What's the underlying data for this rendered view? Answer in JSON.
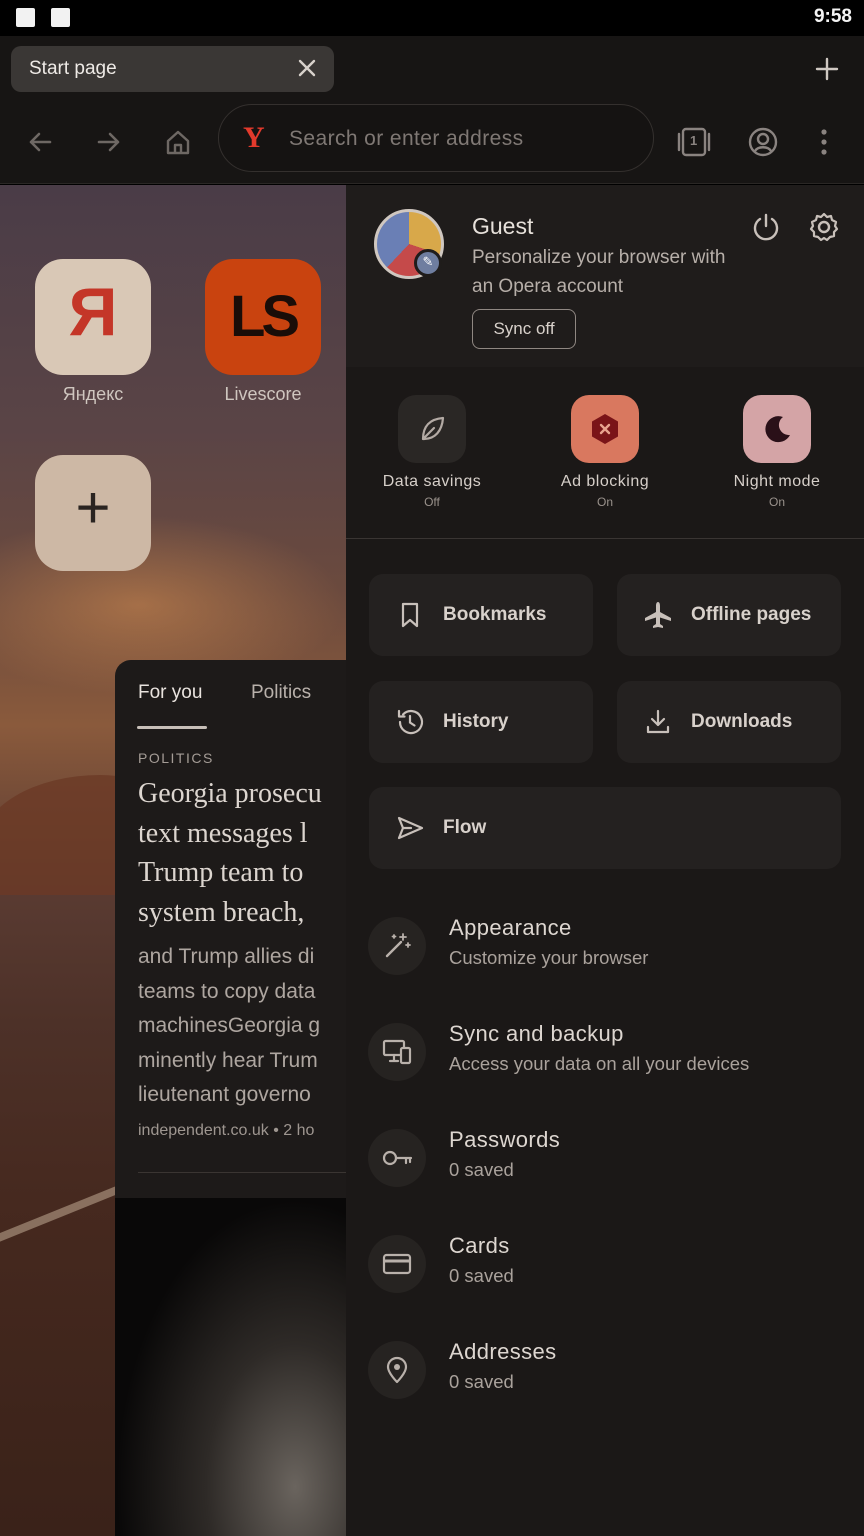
{
  "status_bar": {
    "time": "9:58"
  },
  "tab": {
    "title": "Start page"
  },
  "toolbar": {
    "search_placeholder": "Search or enter address",
    "search_engine_logo": "Y",
    "tab_count": "1"
  },
  "speed_dial": [
    {
      "label": "Яндекс",
      "glyph": "Я"
    },
    {
      "label": "Livescore",
      "glyph": "LS"
    },
    {
      "label": "",
      "glyph": "+"
    }
  ],
  "news": {
    "tabs": [
      "For you",
      "Politics"
    ],
    "category": "POLITICS",
    "headline": "Georgia prosecu\ntext messages l\nTrump team to \nsystem breach,",
    "body": "and Trump allies di\nteams to copy data\nmachinesGeorgia g\nminently hear Trum\nlieutenant governo",
    "source": "independent.co.uk • 2 ho"
  },
  "menu": {
    "profile": {
      "name": "Guest",
      "description": "Personalize your browser with an Opera account",
      "sync_label": "Sync off"
    },
    "toggles": [
      {
        "label": "Data savings",
        "state": "Off",
        "icon": "leaf-icon"
      },
      {
        "label": "Ad blocking",
        "state": "On",
        "icon": "ad-block-icon"
      },
      {
        "label": "Night mode",
        "state": "On",
        "icon": "moon-icon"
      }
    ],
    "grid": [
      {
        "label": "Bookmarks",
        "icon": "bookmark-icon"
      },
      {
        "label": "Offline pages",
        "icon": "airplane-icon"
      },
      {
        "label": "History",
        "icon": "history-icon"
      },
      {
        "label": "Downloads",
        "icon": "download-icon"
      },
      {
        "label": "Flow",
        "icon": "send-icon"
      }
    ],
    "list": [
      {
        "title": "Appearance",
        "subtitle": "Customize your browser",
        "icon": "magic-wand-icon"
      },
      {
        "title": "Sync and backup",
        "subtitle": "Access your data on all your devices",
        "icon": "devices-icon"
      },
      {
        "title": "Passwords",
        "subtitle": "0 saved",
        "icon": "key-icon"
      },
      {
        "title": "Cards",
        "subtitle": "0 saved",
        "icon": "card-icon"
      },
      {
        "title": "Addresses",
        "subtitle": "0 saved",
        "icon": "location-icon"
      }
    ]
  },
  "colors": {
    "menu_bg": "#1b1817",
    "ad_block_accent": "#d9785f",
    "night_mode_accent": "#d4a4a6",
    "yandex_red": "#e23a2c"
  }
}
